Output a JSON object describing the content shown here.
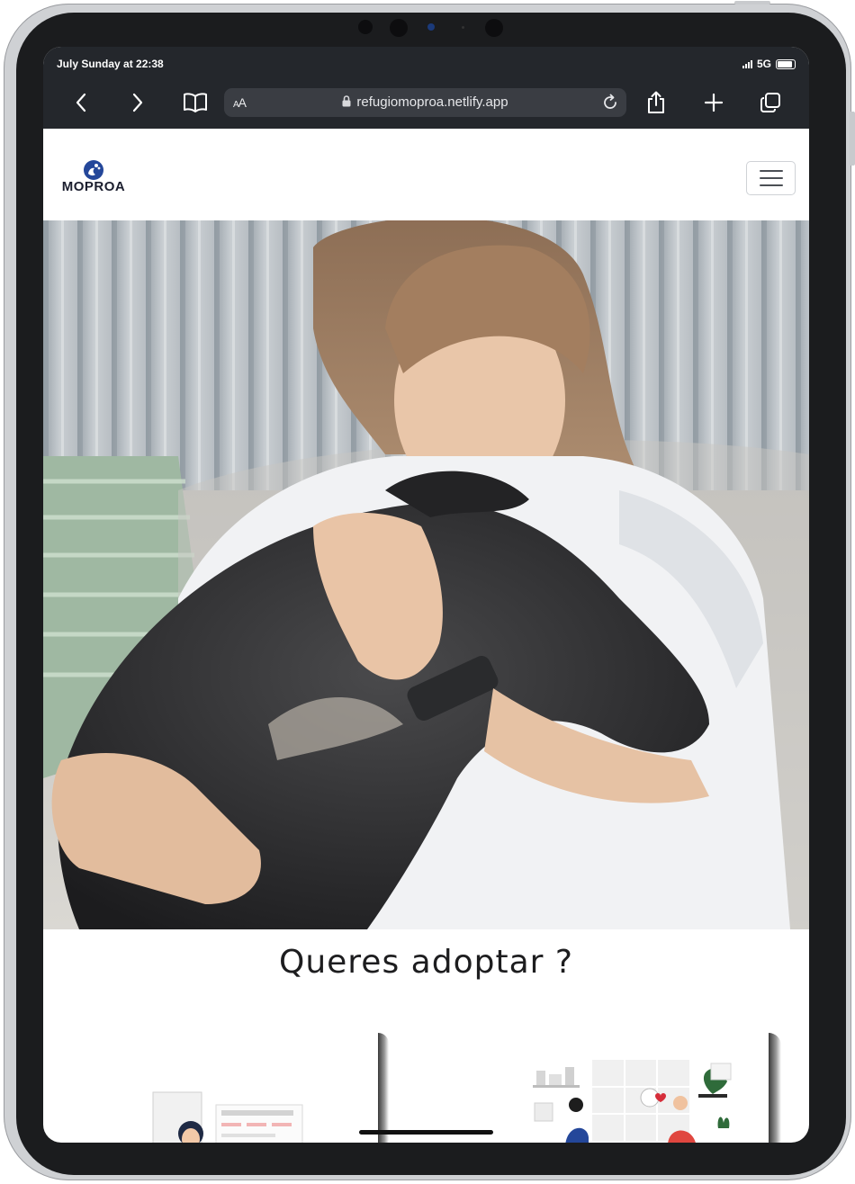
{
  "status_bar": {
    "time": "July Sunday at 22:38",
    "network": "5G"
  },
  "browser": {
    "text_size_label": "AA",
    "url": "refugiomoproa.netlify.app",
    "icons": {
      "back": "chevron-left-icon",
      "forward": "chevron-right-icon",
      "bookmarks": "book-icon",
      "lock": "lock-icon",
      "reload": "reload-icon",
      "share": "share-icon",
      "new_tab": "plus-icon",
      "tabs": "tabs-icon"
    }
  },
  "site": {
    "logo_text": "MOPROA",
    "menu_icon": "hamburger-icon",
    "hero_alt": "Woman hugging a black dog",
    "heading": "Queres adoptar ?"
  },
  "colors": {
    "chrome_bg": "#24272c",
    "address_bg": "#3a3d43",
    "logo_blue": "#24479a",
    "text_dark": "#1d1d1f"
  }
}
